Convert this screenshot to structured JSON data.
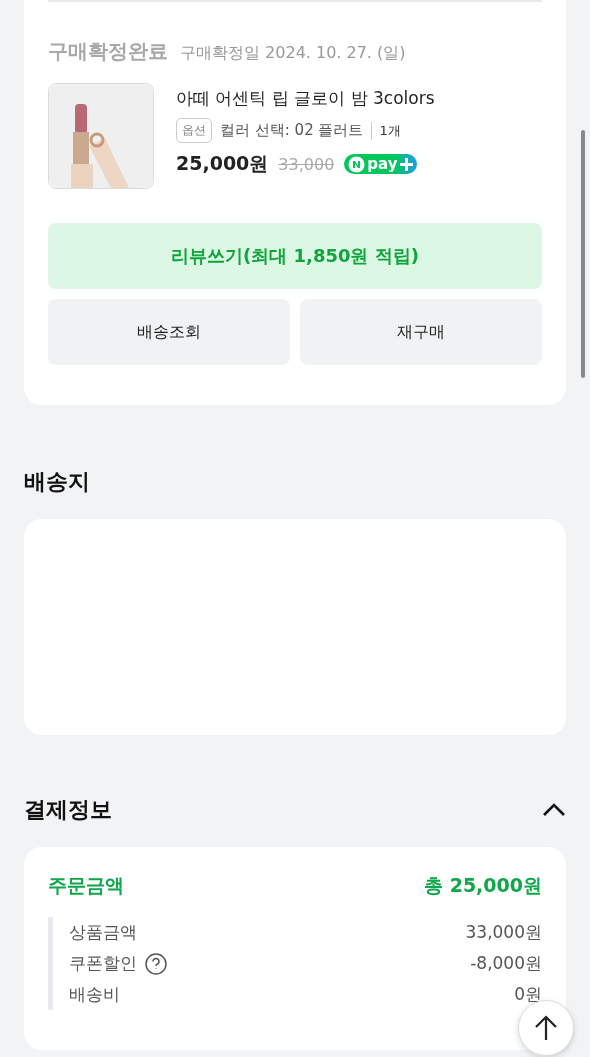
{
  "order": {
    "status": "구매확정완료",
    "confirm_date": "구매확정일 2024. 10. 27. (일)",
    "product": {
      "kind": "picture",
      "name": "아떼 어센틱 립 글로이 밤 3colors",
      "option_tag": "옵션",
      "option": "컬러 선택: 02 플러트",
      "quantity": "1개",
      "price": "25,000원",
      "original_price": "33,000",
      "npay": "pay"
    },
    "review_button": "리뷰쓰기(최대 1,850원 적립)",
    "buttons": [
      "배송조회",
      "재구매"
    ]
  },
  "shipping": {
    "title": "배송지"
  },
  "payment": {
    "title": "결제정보",
    "expanded": true,
    "total_label": "주문금액",
    "total": "총 25,000원",
    "rows": [
      {
        "label": "상품금액",
        "value": "33,000원",
        "help": false
      },
      {
        "label": "쿠폰할인",
        "value": "-8,000원",
        "help": true
      },
      {
        "label": "배송비",
        "value": "0원",
        "help": false
      }
    ]
  }
}
